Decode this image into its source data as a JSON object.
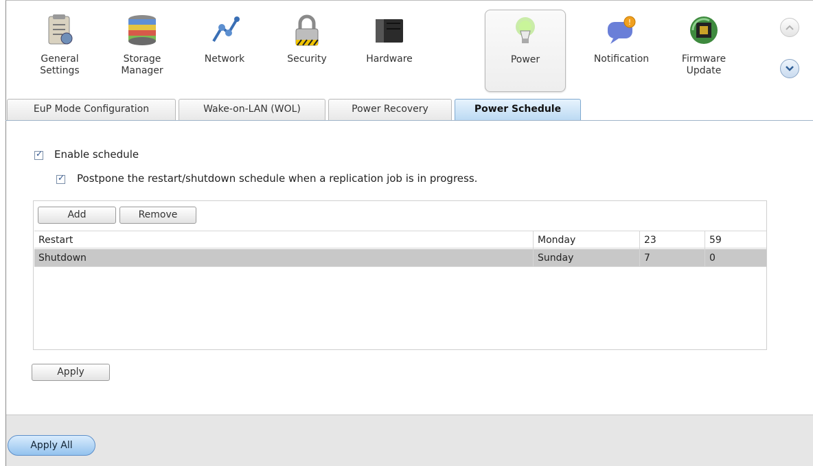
{
  "toolbar": {
    "items": [
      {
        "label": "General\nSettings",
        "icon": "general-settings-icon"
      },
      {
        "label": "Storage\nManager",
        "icon": "storage-manager-icon"
      },
      {
        "label": "Network",
        "icon": "network-icon"
      },
      {
        "label": "Security",
        "icon": "lock-icon"
      },
      {
        "label": "Hardware",
        "icon": "hardware-icon"
      },
      {
        "label": "Power",
        "icon": "lightbulb-icon",
        "active": true
      },
      {
        "label": "Notification",
        "icon": "notification-icon"
      },
      {
        "label": "Firmware\nUpdate",
        "icon": "firmware-chip-icon"
      }
    ]
  },
  "tabs": [
    {
      "label": "EuP Mode Configuration"
    },
    {
      "label": "Wake-on-LAN (WOL)"
    },
    {
      "label": "Power Recovery"
    },
    {
      "label": "Power Schedule",
      "active": true
    }
  ],
  "options": {
    "enable_schedule": {
      "label": "Enable schedule",
      "checked": true
    },
    "postpone": {
      "label": "Postpone the restart/shutdown schedule when a replication job is in progress.",
      "checked": true
    }
  },
  "schedule": {
    "add_label": "Add",
    "remove_label": "Remove",
    "rows": [
      {
        "action": "Restart",
        "day": "Monday",
        "hour": "23",
        "minute": "59",
        "selected": false
      },
      {
        "action": "Shutdown",
        "day": "Sunday",
        "hour": "7",
        "minute": "0",
        "selected": true
      }
    ]
  },
  "apply_label": "Apply",
  "apply_all_label": "Apply All",
  "colors": {
    "accent": "#bcdaf3",
    "selected_row": "#c8c8c8",
    "footer": "#e6e6e6"
  }
}
